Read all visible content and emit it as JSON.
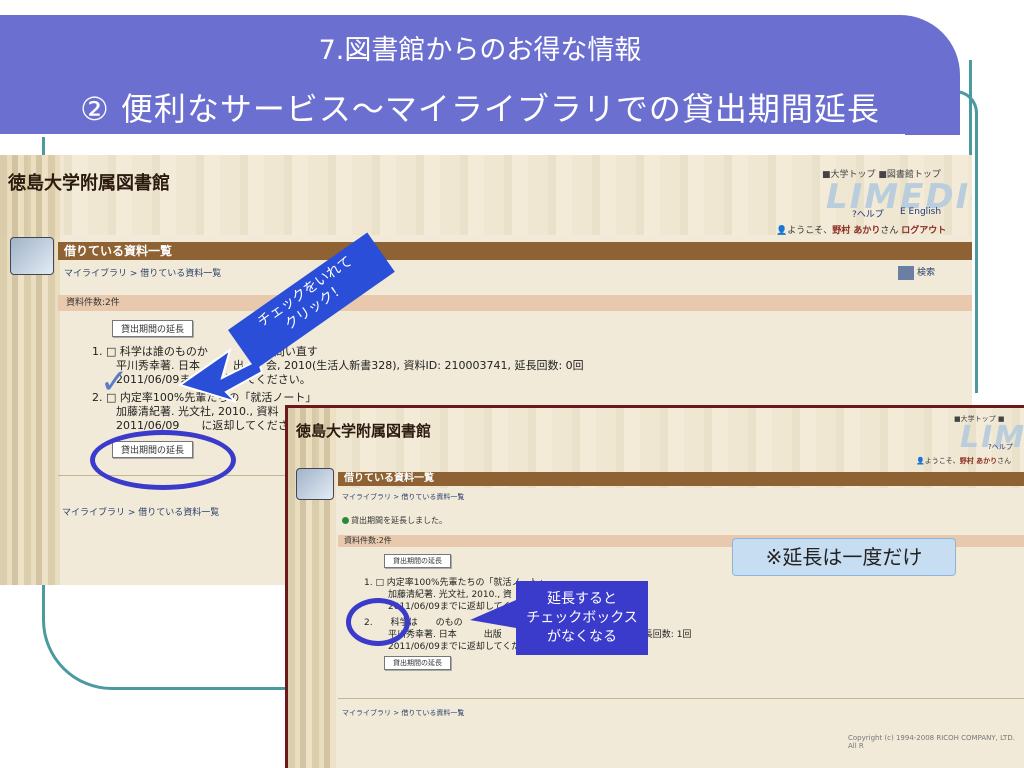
{
  "slide": {
    "title_line1": "7.図書館からのお得な情報",
    "title_line2": "② 便利なサービス～マイライブラリでの貸出期間延長"
  },
  "screen1": {
    "library_name": "徳島大学附属図書館",
    "top_links": "■大学トップ ■図書館トップ",
    "logo": "LIMEDIO",
    "help_link": "?ヘルプ",
    "english_link": "E English",
    "welcome_text": "ようこそ、",
    "user_name": "野村 あかり",
    "welcome_suffix": "さん",
    "logout": "ログアウト",
    "section_title": "借りている資料一覧",
    "breadcrumb": "マイライブラリ > 借りている資料一覧",
    "search_label": "検索",
    "count": "資料件数:2件",
    "extend_button": "貸出期間の延長",
    "items": [
      {
        "title": "1. □ 科学は誰のものか　　　　　ら問い直す",
        "detail": "平川秀幸著. 日本　　　出　　会, 2010(生活人新書328), 資料ID: 210003741, 延長回数: 0回",
        "due": "2011/06/09ま　　返却してください。"
      },
      {
        "title": "2. □ 内定率100%先輩たちの「就活ノート」",
        "detail": "加藤清紀著. 光文社, 2010., 資料",
        "due": "2011/06/09　　に返却してくださ"
      }
    ],
    "footer_breadcrumb": "マイライブラリ > 借りている資料一覧"
  },
  "screen2": {
    "library_name": "徳島大学附属図書館",
    "top_links": "■大学トップ ■",
    "logo": "LIM",
    "help_link": "?ヘルプ",
    "welcome_text": "ようこそ、",
    "user_name": "野村 あかり",
    "welcome_suffix": "さん",
    "section_title": "借りている資料一覧",
    "breadcrumb": "マイライブラリ > 借りている資料一覧",
    "notice": "貸出期間を延長しました。",
    "count": "資料件数:2件",
    "extend_button": "貸出期間の延長",
    "items": [
      {
        "title": "1. □ 内定率100%先輩たちの「就活ノート」",
        "detail": "加藤清紀著. 光文社, 2010., 資",
        "due": "2011/06/09までに返却してくだ"
      },
      {
        "title": "2.　　科学は　　のもの",
        "detail": "平川秀幸著. 日本　　　出版　　　　　　　D: 210003741, 延長回数: 1回",
        "due": "2011/06/09までに返却してくだ"
      }
    ],
    "footer_breadcrumb": "マイライブラリ > 借りている資料一覧",
    "copyright": "Copyright (c) 1994-2008 RICOH COMPANY, LTD. All R"
  },
  "annotations": {
    "arrow_line1": "チェックをいれて",
    "arrow_line2": "クリック！",
    "note_once": "※延長は一度だけ",
    "extend_note_1": "延長すると",
    "extend_note_2": "チェックボックス",
    "extend_note_3": "がなくなる"
  },
  "colors": {
    "title_band": "#6b6fd0",
    "frame": "#4a9aa0",
    "section_bar": "#8e6233",
    "annotation_blue": "#3a3acb",
    "arrow_blue": "#2a4ed8"
  }
}
